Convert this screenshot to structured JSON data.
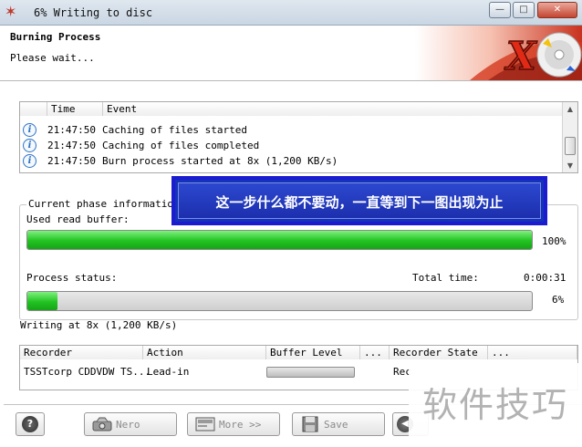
{
  "window": {
    "title": "6% Writing to disc",
    "minimize_glyph": "—",
    "maximize_glyph": "□",
    "close_glyph": "✕",
    "app_icon": "nero-flame-icon"
  },
  "header": {
    "title": "Burning Process",
    "subtitle": "Please wait...",
    "logo_letter": "X"
  },
  "log": {
    "columns": [
      "Time",
      "Event"
    ],
    "rows": [
      {
        "icon": "info-icon",
        "time": "21:47:50",
        "event": "Caching of files started"
      },
      {
        "icon": "info-icon",
        "time": "21:47:50",
        "event": "Caching of files completed"
      },
      {
        "icon": "info-icon",
        "time": "21:47:50",
        "event": "Burn process started at 8x (1,200 KB/s)"
      }
    ]
  },
  "phase": {
    "group_label": "Current phase information",
    "buffer_label": "Used read buffer:",
    "buffer_percent_text": "100%",
    "buffer_fraction": 1.0,
    "process_label": "Process status:",
    "total_time_label": "Total time:",
    "total_time_value": "0:00:31",
    "process_percent_text": "6%",
    "process_fraction": 0.06
  },
  "status_line": "Writing at 8x (1,200 KB/s)",
  "overlay_note": "这一步什么都不要动，一直等到下一图出现为止",
  "recorders": {
    "columns": [
      "Recorder",
      "Action",
      "Buffer Level",
      "...",
      "Recorder State",
      "..."
    ],
    "row": {
      "recorder": "TSSTcorp CDDVDW TS...",
      "action": "Lead-in",
      "buffer_fraction": 0.0,
      "state": "Rec"
    }
  },
  "buttons": {
    "help_glyph": "?",
    "nero_label": "Nero",
    "more_label": "More >>",
    "save_label": "Save"
  },
  "watermark": "软件技巧",
  "colors": {
    "progress_green": "#21c321",
    "overlay_blue": "#1433b8",
    "title_bar": "#dfe7ef"
  }
}
